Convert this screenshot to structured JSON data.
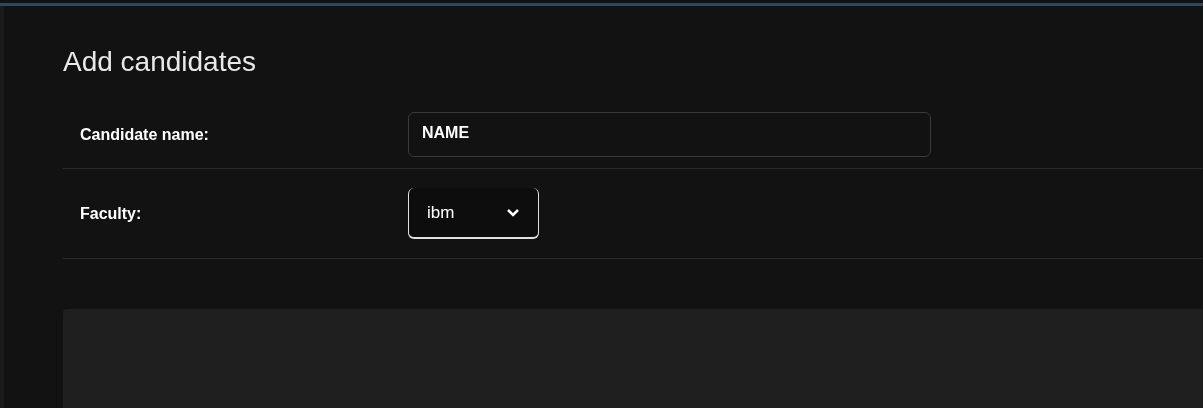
{
  "title": "Add candidates",
  "fields": [
    {
      "kind": "text",
      "label": "Candidate name:",
      "value": "NAME"
    },
    {
      "kind": "select",
      "label": "Faculty:",
      "value": "ibm"
    }
  ]
}
